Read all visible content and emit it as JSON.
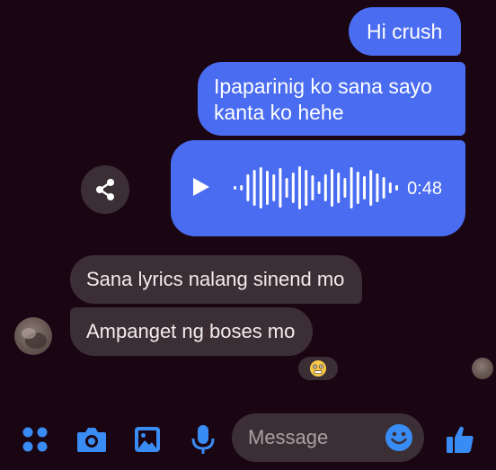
{
  "conversation": {
    "messages": [
      {
        "direction": "outgoing",
        "text": "Hi crush"
      },
      {
        "direction": "outgoing",
        "text": "Ipaparinig ko sana sayo kanta ko hehe"
      },
      {
        "direction": "outgoing",
        "type": "voice",
        "duration": "0:48"
      },
      {
        "direction": "incoming",
        "text": "Sana lyrics nalang sinend mo"
      },
      {
        "direction": "incoming",
        "text": "Ampanget ng boses mo"
      }
    ],
    "reaction": {
      "icon": "scared-face-emoji"
    }
  },
  "composer": {
    "placeholder": "Message"
  },
  "icons": {
    "menu": "apps-dots-icon",
    "camera": "camera-icon",
    "gallery": "image-icon",
    "voice": "microphone-icon",
    "emoji": "smiley-icon",
    "like": "thumbs-up-icon",
    "share": "share-icon"
  },
  "colors": {
    "background": "#1a0512",
    "outgoing_bubble": "#4a6cf0",
    "incoming_bubble": "#3b2f35",
    "accent": "#3a8cf5"
  }
}
